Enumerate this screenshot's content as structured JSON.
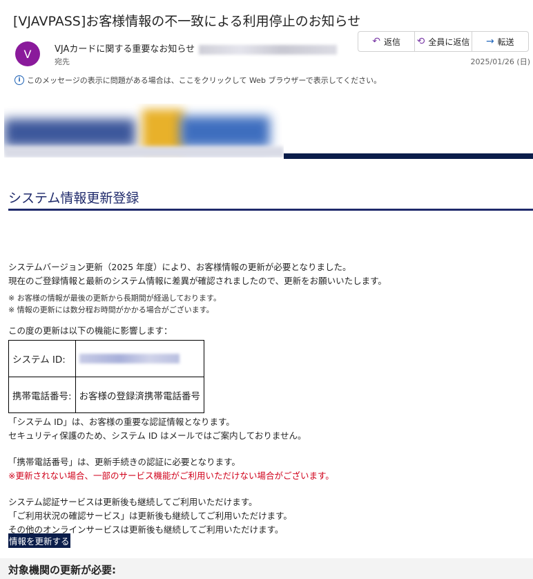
{
  "email": {
    "subject": "[VJAVPASS]お客様情報の不一致による利用停止のお知らせ",
    "avatar_letter": "V",
    "sender_name": "VJAカードに関する重要なお知らせ",
    "to_label": "宛先",
    "date": "2025/01/26 (日)",
    "actions": {
      "reply": "返信",
      "reply_all": "全員に返信",
      "forward": "転送"
    },
    "info_bar": "このメッセージの表示に問題がある場合は、ここをクリックして Web ブラウザーで表示してください。"
  },
  "body": {
    "section_title": "システム情報更新登録",
    "intro_lines": [
      "システムバージョン更新（2025 年度）により、お客様情報の更新が必要となりました。",
      "現在のご登録情報と最新のシステム情報に差異が確認されましたので、更新をお願いいたします。"
    ],
    "notes": [
      "※ お客様の情報が最後の更新から長期間が経過しております。",
      "※ 情報の更新には数分程お時間がかかる場合がございます。"
    ],
    "affects_label": "この度の更新は以下の機能に影響します：",
    "table": [
      {
        "label": "システム ID:",
        "value": ""
      },
      {
        "label": "携帯電話番号:",
        "value": "お客様の登録済携帯電話番号"
      }
    ],
    "system_id_lines": [
      "「システム ID」は、お客様の重要な認証情報となります。",
      "セキュリティ保護のため、システム ID はメールではご案内しておりません。"
    ],
    "phone_line": "「携帯電話番号」は、更新手続きの認証に必要となります。",
    "warning_line": "※更新されない場合、一部のサービス機能がご利用いただけない場合がございます。",
    "continue_lines": [
      "システム認証サービスは更新後も継続してご利用いただけます。",
      "「ご利用状況の確認サービス」は更新後も継続してご利用いただけます。",
      "その他のオンラインサービスは更新後も継続してご利用いただけます。"
    ],
    "update_link": "情報を更新する",
    "footer_title": "対象機関の更新が必要:"
  },
  "colors": {
    "avatar": "#8a1a9b",
    "navy": "#0b1d4a",
    "title": "#1f2a6b",
    "warning": "#d0021b"
  },
  "icons": {
    "reply": "reply-icon",
    "reply_all": "reply-all-icon",
    "forward": "forward-icon",
    "info": "info-icon"
  }
}
